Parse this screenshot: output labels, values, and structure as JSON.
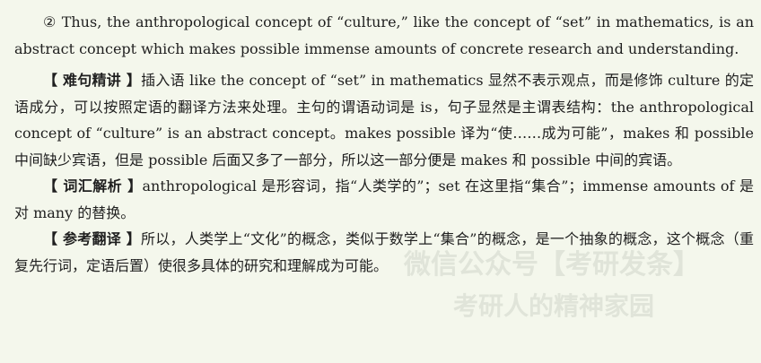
{
  "p1": "② Thus, the anthropological concept of “culture,” like the concept of “set” in mathematics, is an abstract concept which makes possible immense amounts of concrete research and understanding.",
  "p2_label": "【 难句精讲 】",
  "p2_text": "插入语 like the concept of “set” in mathematics 显然不表示观点，而是修饰 culture 的定语成分，可以按照定语的翻译方法来处理。主句的谓语动词是 is，句子显然是主谓表结构：the anthropological concept of “culture” is an abstract concept。makes possible 译为“使……成为可能”，makes 和 possible 中间缺少宾语，但是 possible 后面又多了一部分，所以这一部分便是 makes 和 possible 中间的宾语。",
  "p3_label": "【 词汇解析 】",
  "p3_text": "anthropological 是形容词，指“人类学的”；set 在这里指“集合”；immense amounts of 是对 many 的替换。",
  "p4_label": "【 参考翻译 】",
  "p4_text": "所以，人类学上“文化”的概念，类似于数学上“集合”的概念，是一个抽象的概念，这个概念（重复先行词，定语后置）使很多具体的研究和理解成为可能。",
  "watermark_1": "微信公众号【考研发条】",
  "watermark_2": "考研人的精神家园"
}
